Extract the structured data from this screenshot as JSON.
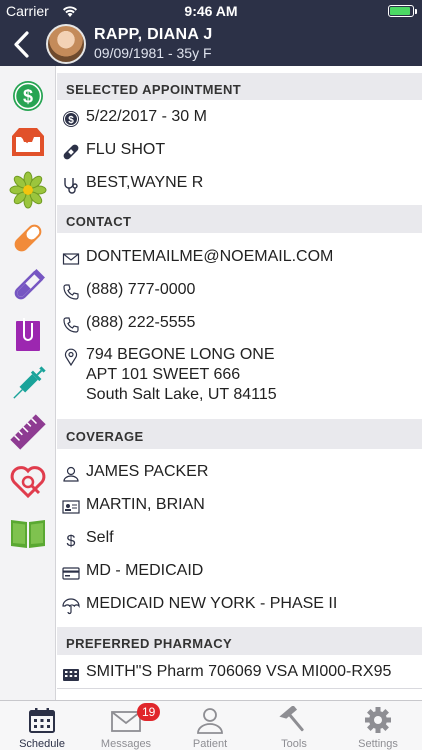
{
  "status_bar": {
    "carrier": "Carrier",
    "time": "9:46 AM",
    "battery_level": 0.9
  },
  "header": {
    "back_icon": "chevron-left-icon",
    "patient_name": "RAPP, DIANA J",
    "patient_dob": "09/09/1981 - 35y F"
  },
  "sidebar": {
    "icons": [
      "billing-dollar-icon",
      "inbox-tray-icon",
      "flower-icon",
      "capsule-icon",
      "test-tube-icon",
      "clipboard-icon",
      "syringe-icon",
      "ruler-icon",
      "heart-stethoscope-icon",
      "book-icon"
    ]
  },
  "sections": {
    "appointment": {
      "header": "SELECTED APPOINTMENT",
      "date": "5/22/2017 - 30 M",
      "reason": "FLU SHOT",
      "provider": "BEST,WAYNE R"
    },
    "contact": {
      "header": "CONTACT",
      "email": "DONTEMAILME@NOEMAIL.COM",
      "phone1": "(888) 777-0000",
      "phone2": "(888) 222-5555",
      "address_line1": "794 BEGONE LONG ONE",
      "address_line2": "APT 101 SWEET 666",
      "address_line3": "South Salt Lake, UT 84115"
    },
    "coverage": {
      "header": "COVERAGE",
      "subscriber": "JAMES PACKER",
      "guarantor": "MARTIN, BRIAN",
      "relationship": "Self",
      "plan_type": "MD - MEDICAID",
      "plan_name": "MEDICAID NEW YORK - PHASE II"
    },
    "pharmacy": {
      "header": "PREFERRED PHARMACY",
      "name": "SMITH\"S Pharm 706069 VSA MI000-RX95"
    }
  },
  "tabbar": {
    "tabs": [
      {
        "label": "Schedule",
        "icon": "calendar-icon",
        "active": true
      },
      {
        "label": "Messages",
        "icon": "envelope-icon",
        "badge": "19"
      },
      {
        "label": "Patient",
        "icon": "person-icon"
      },
      {
        "label": "Tools",
        "icon": "hammer-icon"
      },
      {
        "label": "Settings",
        "icon": "gear-icon"
      }
    ]
  },
  "colors": {
    "header_bg": "#2c3147",
    "accent": "#2c3147",
    "badge": "#e0262b"
  }
}
